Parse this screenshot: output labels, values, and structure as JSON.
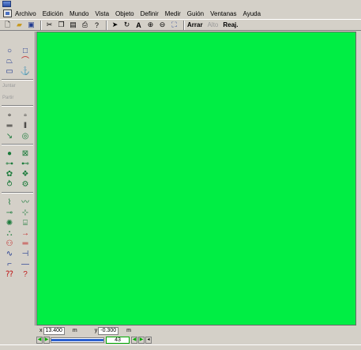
{
  "menu": [
    "Archivo",
    "Edición",
    "Mundo",
    "Vista",
    "Objeto",
    "Definir",
    "Medir",
    "Guión",
    "Ventanas",
    "Ayuda"
  ],
  "toolbar": {
    "arrange_label": "Arrar",
    "height_label": "Alto",
    "reset_label": "Reaj."
  },
  "palette": {
    "join_label": "Juntar",
    "split_label": "Partir"
  },
  "status": {
    "x_label": "x",
    "x_value": "13.400",
    "x_unit": "m",
    "y_label": "y",
    "y_value": "-0.300",
    "y_unit": "m",
    "zoom_value": "43"
  },
  "colors": {
    "canvas_background": "#00ee44",
    "chrome": "#d4d0c8"
  }
}
